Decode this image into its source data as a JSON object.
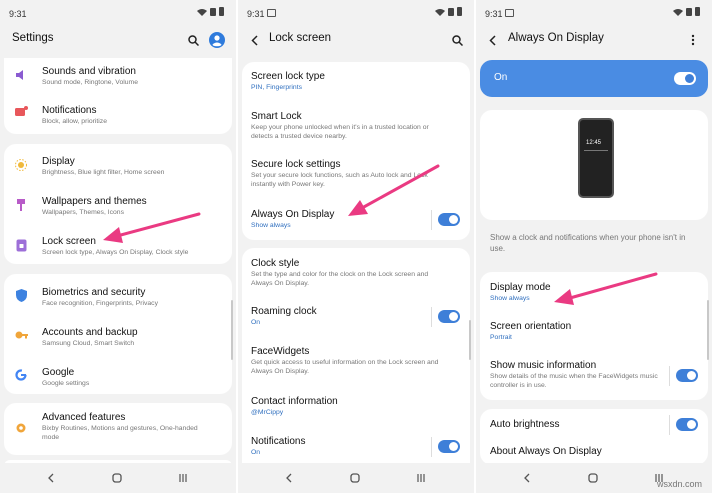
{
  "colors": {
    "accent": "#3e7fd8",
    "toggle_bar_bg": "#4a8ce3",
    "arrow": "#ea3a82",
    "link": "#2f6fbf"
  },
  "screen1": {
    "status_time": "9:31",
    "title": "Settings",
    "items": [
      {
        "label": "Sounds and vibration",
        "sub": "Sound mode, Ringtone, Volume",
        "icon": "volume-icon"
      },
      {
        "label": "Notifications",
        "sub": "Block, allow, prioritize",
        "icon": "notification-icon"
      },
      {
        "label": "Display",
        "sub": "Brightness, Blue light filter, Home screen",
        "icon": "display-icon"
      },
      {
        "label": "Wallpapers and themes",
        "sub": "Wallpapers, Themes, Icons",
        "icon": "brush-icon"
      },
      {
        "label": "Lock screen",
        "sub": "Screen lock type, Always On Display, Clock style",
        "icon": "lock-screen-icon"
      },
      {
        "label": "Biometrics and security",
        "sub": "Face recognition, Fingerprints, Privacy",
        "icon": "shield-icon"
      },
      {
        "label": "Accounts and backup",
        "sub": "Samsung Cloud, Smart Switch",
        "icon": "key-icon"
      },
      {
        "label": "Google",
        "sub": "Google settings",
        "icon": "google-icon"
      },
      {
        "label": "Advanced features",
        "sub": "Bixby Routines, Motions and gestures, One-handed mode",
        "icon": "gear-icon"
      }
    ]
  },
  "screen2": {
    "status_time": "9:31",
    "title": "Lock screen",
    "items": [
      {
        "label": "Screen lock type",
        "sub": "PIN, Fingerprints",
        "sub_blue": true
      },
      {
        "label": "Smart Lock",
        "sub": "Keep your phone unlocked when it's in a trusted location or detects a trusted device nearby."
      },
      {
        "label": "Secure lock settings",
        "sub": "Set your secure lock functions, such as Auto lock and Lock instantly with Power key."
      },
      {
        "label": "Always On Display",
        "sub": "Show always",
        "sub_blue": true,
        "toggle": true
      },
      {
        "label": "Clock style",
        "sub": "Set the type and color for the clock on the Lock screen and Always On Display."
      },
      {
        "label": "Roaming clock",
        "sub": "On",
        "sub_blue": true,
        "toggle": true
      },
      {
        "label": "FaceWidgets",
        "sub": "Get quick access to useful information on the Lock screen and Always On Display."
      },
      {
        "label": "Contact information",
        "sub": "@MrCippy",
        "sub_blue": true
      },
      {
        "label": "Notifications",
        "sub": "On",
        "sub_blue": true,
        "toggle": true
      }
    ]
  },
  "screen3": {
    "status_time": "9:31",
    "title": "Always On Display",
    "master_toggle_label": "On",
    "preview_clock": "12:45",
    "description": "Show a clock and notifications when your phone isn't in use.",
    "items": [
      {
        "label": "Display mode",
        "sub": "Show always",
        "sub_blue": true
      },
      {
        "label": "Screen orientation",
        "sub": "Portrait",
        "sub_blue": true
      },
      {
        "label": "Show music information",
        "sub": "Show details of the music when the FaceWidgets music controller is in use.",
        "toggle": true
      },
      {
        "label": "Auto brightness",
        "toggle": true
      },
      {
        "label": "About Always On Display"
      }
    ]
  },
  "watermark": "wsxdn.com"
}
